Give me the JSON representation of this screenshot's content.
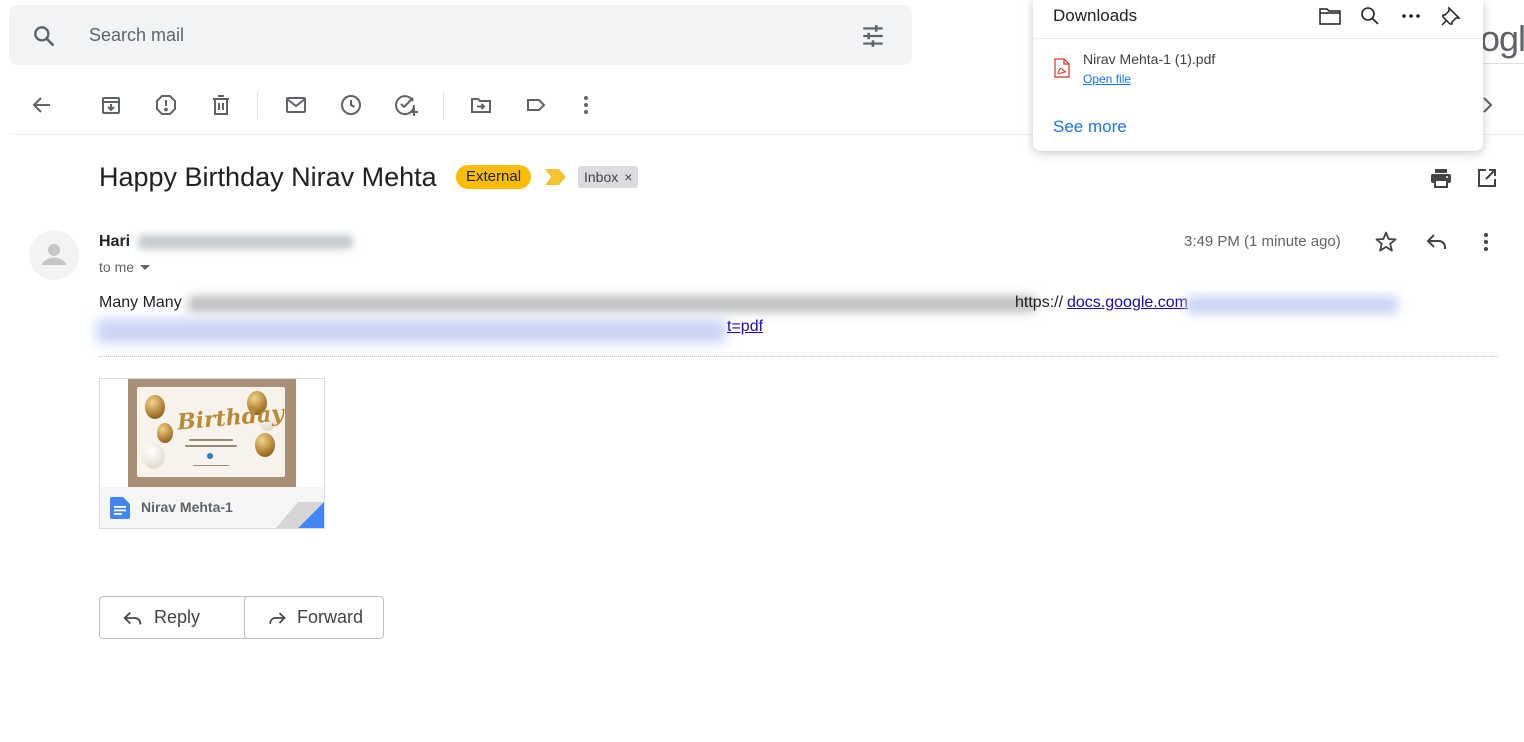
{
  "search": {
    "placeholder": "Search mail"
  },
  "logo_fragment": "ogle",
  "subject": {
    "title": "Happy Birthday Nirav Mehta",
    "external_label": "External",
    "inbox_label": "Inbox",
    "inbox_close": "×"
  },
  "message": {
    "sender": "Hari",
    "recipient": "to me",
    "time": "3:49 PM (1 minute ago)",
    "body_start": "Many Many",
    "link_text": "docs.google.com",
    "link_prefix": "https://",
    "link_suffix": "t=pdf"
  },
  "attachment": {
    "name": "Nirav Mehta-1"
  },
  "actions": {
    "reply": "Reply",
    "forward": "Forward"
  },
  "downloads": {
    "title": "Downloads",
    "file_name": "Nirav Mehta-1 (1).pdf",
    "open_file": "Open file",
    "see_more": "See more"
  },
  "colors": {
    "external_badge": "#fbbc04",
    "important_marker": "#f4c430",
    "link": "#1a0dab",
    "download_link": "#1a73e8",
    "docs_icon": "#4285f4",
    "pdf_icon": "#d93025"
  },
  "icons": {
    "toolbar": [
      "back-arrow-icon",
      "archive-icon",
      "report-spam-icon",
      "delete-icon",
      "mark-unread-icon",
      "snooze-icon",
      "add-task-icon",
      "move-to-icon",
      "label-icon",
      "more-vert-icon"
    ],
    "header": [
      "print-icon",
      "open-new-window-icon"
    ],
    "message": [
      "star-icon",
      "reply-icon",
      "more-vert-icon"
    ],
    "downloads": [
      "folder-icon",
      "search-icon",
      "more-horiz-icon",
      "pin-icon"
    ]
  }
}
